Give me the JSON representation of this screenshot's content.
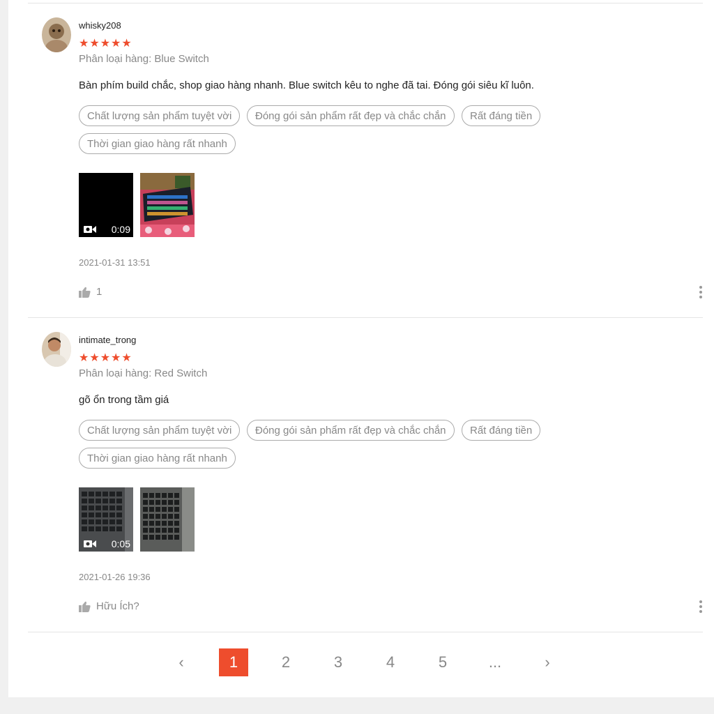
{
  "colors": {
    "accent": "#ee4d2d",
    "muted": "#888888",
    "border": "#e4e4e4"
  },
  "reviews": [
    {
      "author": "whisky208",
      "rating": 5,
      "stars": "★★★★★",
      "variation": "Phân loại hàng: Blue Switch",
      "comment": "Bàn phím build chắc, shop giao hàng nhanh. Blue switch kêu to nghe đã tai. Đóng gói siêu kĩ luôn.",
      "tags": [
        "Chất lượng sản phẩm tuyệt vời",
        "Đóng gói sản phẩm rất đẹp và chắc chắn",
        "Rất đáng tiền",
        "Thời gian giao hàng rất nhanh"
      ],
      "video_duration": "0:09",
      "date": "2021-01-31 13:51",
      "likes": "1"
    },
    {
      "author": "intimate_trong",
      "rating": 5,
      "stars": "★★★★★",
      "variation": "Phân loại hàng: Red Switch",
      "comment": "gõ ổn trong tầm giá",
      "tags": [
        "Chất lượng sản phẩm tuyệt vời",
        "Đóng gói sản phẩm rất đẹp và chắc chắn",
        "Rất đáng tiền",
        "Thời gian giao hàng rất nhanh"
      ],
      "video_duration": "0:05",
      "date": "2021-01-26 19:36",
      "likes": "Hữu Ích?"
    }
  ],
  "pagination": {
    "prev": "‹",
    "pages": [
      "1",
      "2",
      "3",
      "4",
      "5"
    ],
    "ellipsis": "...",
    "next": "›",
    "current": "1"
  },
  "icons": {
    "avatar_1": "avatar-icon",
    "avatar_2": "avatar-icon",
    "like": "thumbs-up-icon",
    "more": "more-vertical-icon",
    "video": "video-camera-icon"
  }
}
